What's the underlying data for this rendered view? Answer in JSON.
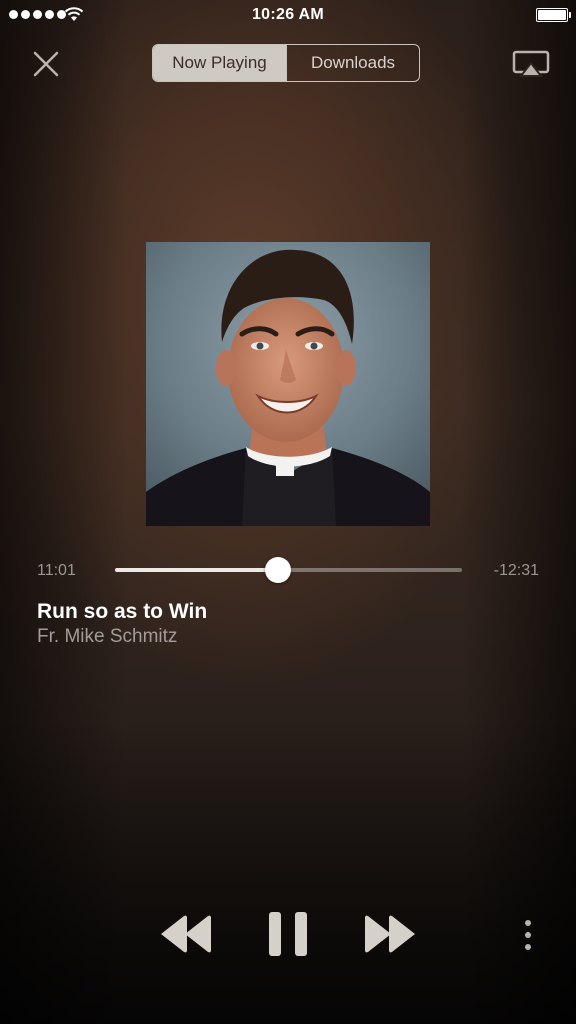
{
  "status_bar": {
    "time": "10:26 AM",
    "signal_icon": "signal-dots-icon",
    "wifi_icon": "wifi-icon",
    "battery_icon": "battery-icon"
  },
  "header": {
    "close_icon": "close-icon",
    "tabs": [
      {
        "label": "Now Playing",
        "active": true
      },
      {
        "label": "Downloads",
        "active": false
      }
    ],
    "airplay_icon": "airplay-icon"
  },
  "player": {
    "elapsed": "11:01",
    "remaining": "-12:31",
    "progress": 0.47,
    "track_title": "Run so as to Win",
    "artist": "Fr. Mike Schmitz",
    "artwork_icon": "album-artwork-portrait"
  },
  "controls": {
    "rewind_icon": "rewind-icon",
    "pause_icon": "pause-icon",
    "forward_icon": "fast-forward-icon",
    "more_icon": "more-vertical-icon"
  },
  "colors": {
    "accent": "#cfc9c4",
    "secondary_text": "#9b9591"
  }
}
